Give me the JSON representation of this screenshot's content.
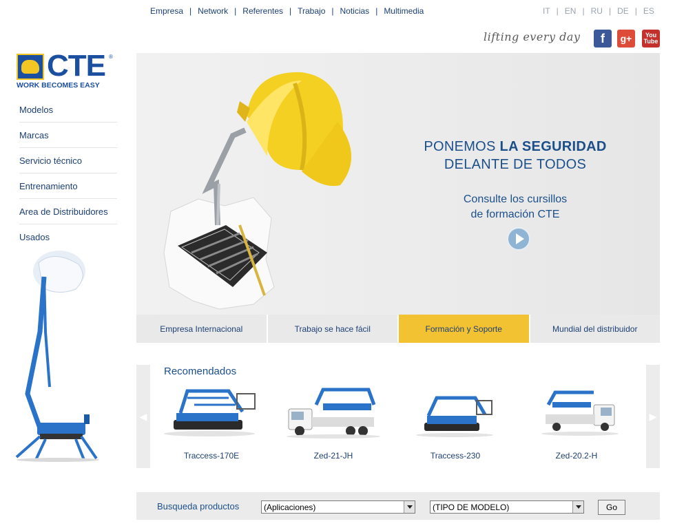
{
  "topnav": {
    "items": [
      "Empresa",
      "Network",
      "Referentes",
      "Trabajo",
      "Noticias",
      "Multimedia"
    ],
    "separator": "|"
  },
  "languages": [
    "IT",
    "EN",
    "RU",
    "DE",
    "ES"
  ],
  "tagline": "lifting every day",
  "social": {
    "facebook": "f",
    "googleplus": "g+",
    "youtube_line1": "You",
    "youtube_line2": "Tube"
  },
  "logo": {
    "word": "CTE",
    "reg": "®",
    "claim": "WORK BECOMES EASY"
  },
  "sidemenu": [
    "Modelos",
    "Marcas",
    "Servicio técnico",
    "Entrenamiento",
    "Area de Distribuidores",
    "Usados"
  ],
  "hero": {
    "line1_a": "PONEMOS ",
    "line1_b": "LA SEGURIDAD",
    "line2": "DELANTE DE TODOS",
    "line3": "Consulte los cursillos",
    "line4": "de formación CTE"
  },
  "tabs": [
    {
      "label": "Empresa Internacional",
      "active": false
    },
    {
      "label": "Trabajo se hace fácil",
      "active": false
    },
    {
      "label": "Formación y Soporte",
      "active": true
    },
    {
      "label": "Mundial del distribuidor",
      "active": false
    }
  ],
  "recommended": {
    "title": "Recomendados",
    "products": [
      "Traccess-170E",
      "Zed-21-JH",
      "Traccess-230",
      "Zed-20.2-H"
    ],
    "prev_arrow": "◀",
    "next_arrow": "▶"
  },
  "search": {
    "label": "Busqueda productos",
    "applications": "(Aplicaciones)",
    "model_type": "(TIPO DE MODELO)",
    "go": "Go"
  },
  "colors": {
    "brand_blue": "#1b4fa0",
    "accent_yellow": "#f2c232",
    "text_blue": "#1c3f74"
  }
}
